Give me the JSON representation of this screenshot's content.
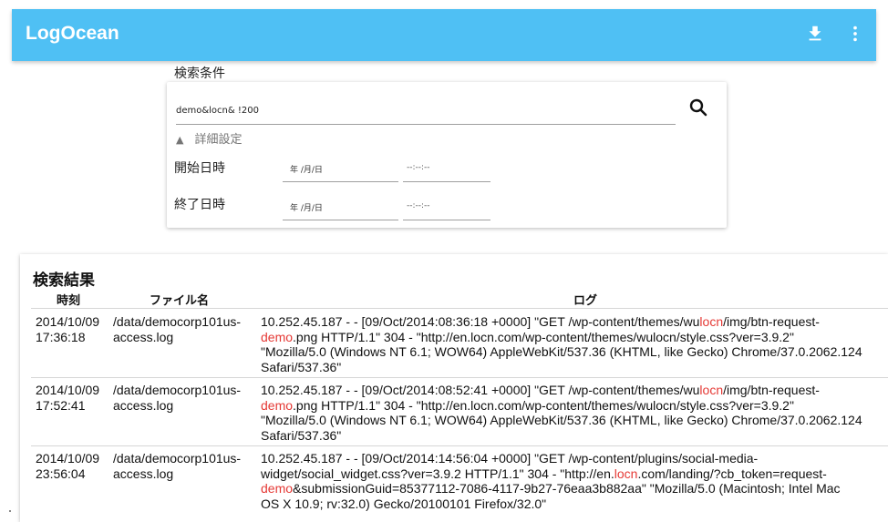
{
  "app": {
    "title": "LogOcean"
  },
  "search": {
    "label": "検索条件",
    "query": "demo&locn& !200",
    "advanced_label": "詳細設定",
    "advanced_toggle": "▲",
    "start_label": "開始日時",
    "end_label": "終了日時",
    "start_date": "年 /月/日",
    "start_time": "--:--:--",
    "end_date": "年 /月/日",
    "end_time": "--:--:--"
  },
  "results": {
    "title": "検索結果",
    "columns": [
      "時刻",
      "ファイル名",
      "ログ"
    ],
    "rows": [
      {
        "time": [
          "2014/10/09",
          "17:36:18"
        ],
        "file": [
          "/data/democorp101us-",
          "access.log"
        ],
        "log": [
          [
            "10.252.45.187 - - [09/Oct/2014:08:36:18 +0000] \"GET /wp-content/themes/wu",
            "locn",
            "/img/btn-request-"
          ],
          [
            "",
            "demo",
            ".png HTTP/1.1\" 304 - \"http://en.locn.com/wp-content/themes/wulocn/style.css?ver=3.9.2\""
          ],
          [
            "\"Mozilla/5.0 (Windows NT 6.1; WOW64) AppleWebKit/537.36 (KHTML, like Gecko) Chrome/37.0.2062.124"
          ],
          [
            "Safari/537.36\""
          ]
        ]
      },
      {
        "time": [
          "2014/10/09",
          "17:52:41"
        ],
        "file": [
          "/data/democorp101us-",
          "access.log"
        ],
        "log": [
          [
            "10.252.45.187 - - [09/Oct/2014:08:52:41 +0000] \"GET /wp-content/themes/wu",
            "locn",
            "/img/btn-request-"
          ],
          [
            "",
            "demo",
            ".png HTTP/1.1\" 304 - \"http://en.locn.com/wp-content/themes/wulocn/style.css?ver=3.9.2\""
          ],
          [
            "\"Mozilla/5.0 (Windows NT 6.1; WOW64) AppleWebKit/537.36 (KHTML, like Gecko) Chrome/37.0.2062.124"
          ],
          [
            "Safari/537.36\""
          ]
        ]
      },
      {
        "time": [
          "2014/10/09",
          "23:56:04"
        ],
        "file": [
          "/data/democorp101us-",
          "access.log"
        ],
        "log": [
          [
            "10.252.45.187 - - [09/Oct/2014:14:56:04 +0000] \"GET /wp-content/plugins/social-media-"
          ],
          [
            "widget/social_widget.css?ver=3.9.2 HTTP/1.1\" 304 - \"http://en.",
            "locn",
            ".com/landing/?cb_token=request-"
          ],
          [
            "",
            "demo",
            "&submissionGuid=85377112-7086-4117-9b27-76eaa3b882aa\" \"Mozilla/5.0 (Macintosh; Intel Mac"
          ],
          [
            "OS X 10.9; rv:32.0) Gecko/20100101 Firefox/32.0\""
          ]
        ]
      }
    ]
  },
  "colors": {
    "appbar": "#4fc0f4",
    "highlight": "#e53935"
  },
  "icons": {
    "download": "download-icon",
    "more": "more-vert-icon",
    "search": "search-icon"
  }
}
